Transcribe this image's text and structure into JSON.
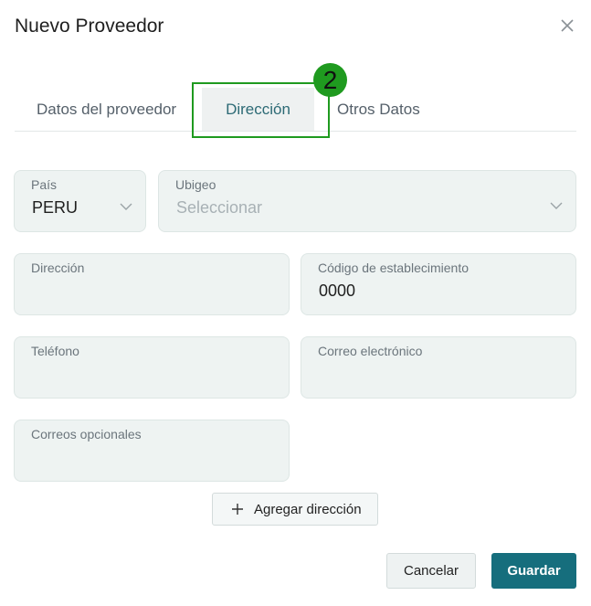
{
  "dialog": {
    "title": "Nuevo Proveedor",
    "close_icon": "close-icon"
  },
  "tabs": [
    {
      "label": "Datos del proveedor",
      "active": false
    },
    {
      "label": "Dirección",
      "active": true
    },
    {
      "label": "Otros Datos",
      "active": false
    }
  ],
  "annotation": {
    "badge_number": "2",
    "color": "#1f9a1f"
  },
  "form": {
    "pais": {
      "label": "País",
      "value": "PERU"
    },
    "ubigeo": {
      "label": "Ubigeo",
      "placeholder": "Seleccionar"
    },
    "direccion": {
      "label": "Dirección",
      "value": ""
    },
    "codigo": {
      "label": "Código de establecimiento",
      "value": "0000"
    },
    "telefono": {
      "label": "Teléfono",
      "value": ""
    },
    "correo": {
      "label": "Correo electrónico",
      "value": ""
    },
    "correos_opcionales": {
      "label": "Correos opcionales",
      "value": ""
    }
  },
  "actions": {
    "add_address": "Agregar dirección",
    "cancel": "Cancelar",
    "save": "Guardar"
  },
  "colors": {
    "accent": "#166e7d",
    "field_bg": "#eef3f2"
  }
}
